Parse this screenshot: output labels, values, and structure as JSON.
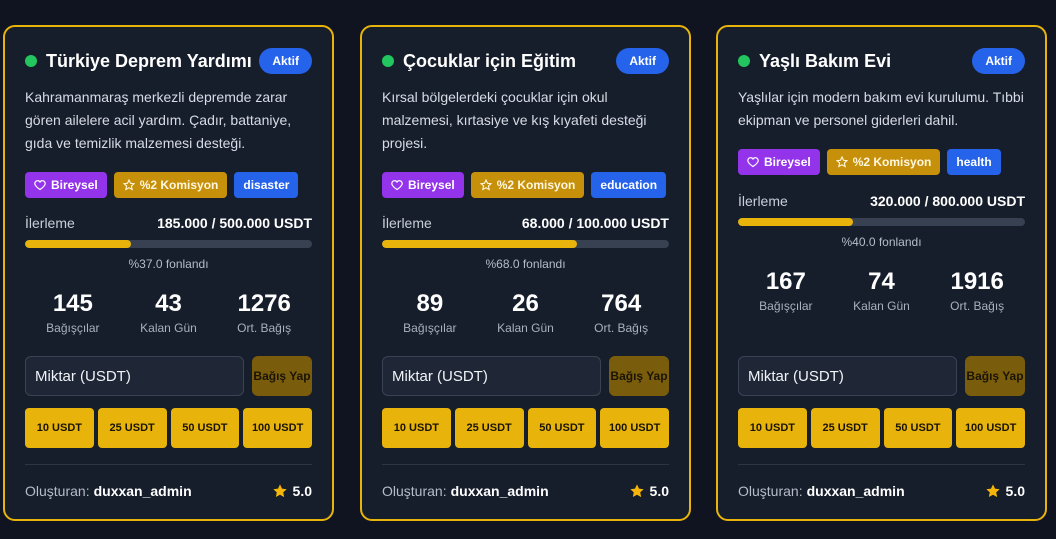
{
  "common": {
    "progress_label": "İlerleme",
    "amount_placeholder": "Miktar (USDT)",
    "donate_label": "Bağış Yap",
    "creator_label": "Oluşturan:",
    "stat_labels": [
      "Bağışçılar",
      "Kalan Gün",
      "Ort. Bağış"
    ],
    "quick_amounts": [
      "10 USDT",
      "25 USDT",
      "50 USDT",
      "100 USDT"
    ],
    "colors": {
      "accent": "#e8b40c",
      "status_active": "#2563eb",
      "online_dot": "#22c55e",
      "tag_individual": "#9333ea"
    }
  },
  "campaigns": [
    {
      "title": "Türkiye Deprem Yardımı",
      "status": "Aktif",
      "description": "Kahramanmaraş merkezli depremde zarar gören ailelere acil yardım. Çadır, battaniye, gıda ve temizlik malzemesi desteği.",
      "tags": {
        "type": "Bireysel",
        "commission": "%2 Komisyon",
        "category": "disaster"
      },
      "progress_amount": "185.000 / 500.000 USDT",
      "progress_fraction": 0.37,
      "funded_text": "%37.0 fonlandı",
      "stats": [
        "145",
        "43",
        "1276"
      ],
      "creator": "duxxan_admin",
      "rating": "5.0"
    },
    {
      "title": "Çocuklar için Eğitim",
      "status": "Aktif",
      "description": "Kırsal bölgelerdeki çocuklar için okul malzemesi, kırtasiye ve kış kıyafeti desteği projesi.",
      "tags": {
        "type": "Bireysel",
        "commission": "%2 Komisyon",
        "category": "education"
      },
      "progress_amount": "68.000 / 100.000 USDT",
      "progress_fraction": 0.68,
      "funded_text": "%68.0 fonlandı",
      "stats": [
        "89",
        "26",
        "764"
      ],
      "creator": "duxxan_admin",
      "rating": "5.0"
    },
    {
      "title": "Yaşlı Bakım Evi",
      "status": "Aktif",
      "description": "Yaşlılar için modern bakım evi kurulumu. Tıbbi ekipman ve personel giderleri dahil.",
      "tags": {
        "type": "Bireysel",
        "commission": "%2 Komisyon",
        "category": "health"
      },
      "progress_amount": "320.000 / 800.000 USDT",
      "progress_fraction": 0.4,
      "funded_text": "%40.0 fonlandı",
      "stats": [
        "167",
        "74",
        "1916"
      ],
      "creator": "duxxan_admin",
      "rating": "5.0"
    }
  ]
}
